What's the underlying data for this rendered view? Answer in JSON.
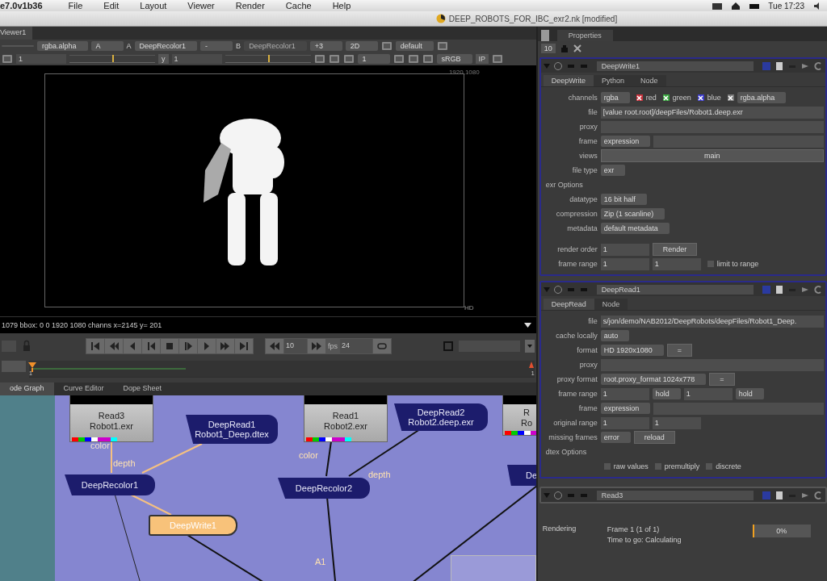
{
  "menu_bar": {
    "app": "e7.0v1b36",
    "menus": [
      "File",
      "Edit",
      "Layout",
      "Viewer",
      "Render",
      "Cache",
      "Help"
    ],
    "clock": "Tue 17:23"
  },
  "title_bar": {
    "title": "DEEP_ROBOTS_FOR_IBC_exr2.nk [modified]"
  },
  "viewer": {
    "tab": "Viewer1",
    "toolbar_1": [
      {
        "kind": "dropdown"
      },
      {
        "kind": "dropdown",
        "value": "rgba.alpha"
      },
      {
        "kind": "dropdown",
        "value": "A"
      },
      {
        "kind": "label",
        "value": "A"
      },
      {
        "kind": "dropdown",
        "value": "DeepRecolor1"
      },
      {
        "kind": "dropdown",
        "value": "-"
      },
      {
        "kind": "label",
        "value": "B"
      },
      {
        "kind": "dropdown",
        "value": "DeepRecolor1",
        "disabled": true
      },
      {
        "kind": "dropdown",
        "value": "+3"
      },
      {
        "kind": "dropdown",
        "value": "2D"
      },
      {
        "kind": "icon"
      },
      {
        "kind": "dropdown",
        "value": "default"
      },
      {
        "kind": "icon"
      }
    ],
    "toolbar_2": [
      {
        "kind": "icon"
      },
      {
        "kind": "field",
        "value": "1"
      },
      {
        "kind": "slider",
        "level": 0.5
      },
      {
        "kind": "button",
        "value": "y"
      },
      {
        "kind": "field",
        "value": "1"
      },
      {
        "kind": "slider",
        "level": 0.5
      },
      {
        "kind": "icon"
      },
      {
        "kind": "icon"
      },
      {
        "kind": "icon"
      },
      {
        "kind": "dropdown",
        "value": "1"
      },
      {
        "kind": "icon"
      },
      {
        "kind": "icon"
      },
      {
        "kind": "icon"
      },
      {
        "kind": "dropdown",
        "value": "sRGB"
      },
      {
        "kind": "button",
        "value": "IP"
      },
      {
        "kind": "icon"
      }
    ],
    "format_label": "1920,1080",
    "format_name": "HD",
    "info": "1079 bbox: 0 0 1920 1080 channs  x=2145 y= 201",
    "frame": "10",
    "fps_label": "fps",
    "fps": "24",
    "timeline": {
      "start": "1",
      "end": "1"
    }
  },
  "node_graph": {
    "tabs": [
      {
        "label": "ode Graph",
        "selected": true
      },
      {
        "label": "Curve Editor",
        "selected": false
      },
      {
        "label": "Dope Sheet",
        "selected": false
      }
    ],
    "nodes": [
      {
        "kind": "read",
        "lines": [
          "Read3",
          "Robot1.exr"
        ],
        "selected": false
      },
      {
        "kind": "deep",
        "lines": [
          "DeepRead1",
          "Robot1_Deep.dtex"
        ],
        "selected": false
      },
      {
        "kind": "read",
        "lines": [
          "Read1",
          "Robot2.exr"
        ],
        "selected": false
      },
      {
        "kind": "deep",
        "lines": [
          "DeepRead2",
          "Robot2.deep.exr"
        ],
        "selected": false
      },
      {
        "kind": "read",
        "lines": [
          "R",
          "Ro"
        ],
        "selected": false
      },
      {
        "kind": "deep",
        "lines": [
          "DeepRecolor1"
        ],
        "selected": false
      },
      {
        "kind": "deep",
        "lines": [
          "DeepRecolor2"
        ],
        "selected": false
      },
      {
        "kind": "deep",
        "lines": [
          "De"
        ],
        "selected": false
      },
      {
        "kind": "deep",
        "lines": [
          "DeepWrite1"
        ],
        "selected": true
      }
    ],
    "edge_labels": [
      "color",
      "depth",
      "color",
      "depth",
      "A1"
    ]
  },
  "properties": {
    "tab": "Properties",
    "max_panels": "10",
    "panels": [
      {
        "name": "DeepWrite1",
        "tabs": [
          {
            "label": "DeepWrite",
            "selected": true
          },
          {
            "label": "Python",
            "selected": false
          },
          {
            "label": "Node",
            "selected": false
          }
        ],
        "rows": [
          {
            "label": "channels",
            "controls": [
              {
                "kind": "dropdown",
                "value": "rgba"
              },
              {
                "kind": "check",
                "label": "red",
                "checked": true,
                "color": "#c8303a"
              },
              {
                "kind": "check",
                "label": "green",
                "checked": true,
                "color": "#3aa640"
              },
              {
                "kind": "check",
                "label": "blue",
                "checked": true,
                "color": "#3a3ac8"
              },
              {
                "kind": "check",
                "checked": true
              },
              {
                "kind": "dropdown",
                "value": "rgba.alpha"
              }
            ]
          },
          {
            "label": "file",
            "controls": [
              {
                "kind": "text",
                "value": "[value root.root]/deepFiles/Robot1.deep.exr"
              }
            ]
          },
          {
            "label": "proxy",
            "controls": [
              {
                "kind": "text"
              }
            ]
          },
          {
            "label": "frame",
            "controls": [
              {
                "kind": "dropdown",
                "value": "expression"
              },
              {
                "kind": "text"
              }
            ]
          },
          {
            "label": "views",
            "controls": [
              {
                "kind": "wide-button",
                "value": "main"
              }
            ]
          },
          {
            "label": "file type",
            "controls": [
              {
                "kind": "dropdown",
                "value": "exr"
              }
            ]
          },
          {
            "label": "exr Options",
            "controls": []
          },
          {
            "label": "datatype",
            "controls": [
              {
                "kind": "dropdown",
                "value": "16 bit half"
              }
            ]
          },
          {
            "label": "compression",
            "controls": [
              {
                "kind": "dropdown",
                "value": "Zip (1 scanline)"
              }
            ]
          },
          {
            "label": "metadata",
            "controls": [
              {
                "kind": "dropdown",
                "value": "default metadata"
              }
            ]
          },
          {
            "label": "render order",
            "controls": [
              {
                "kind": "field",
                "value": "1"
              },
              {
                "kind": "button",
                "value": "Render"
              }
            ]
          },
          {
            "label": "frame range",
            "controls": [
              {
                "kind": "field",
                "value": "1"
              },
              {
                "kind": "field",
                "value": "1"
              },
              {
                "kind": "check",
                "label": "limit to range",
                "checked": false
              }
            ]
          }
        ]
      },
      {
        "name": "DeepRead1",
        "tabs": [
          {
            "label": "DeepRead",
            "selected": true
          },
          {
            "label": "Node",
            "selected": false
          }
        ],
        "rows": [
          {
            "label": "file",
            "controls": [
              {
                "kind": "text",
                "value": "s/jon/demo/NAB2012/DeepRobots/deepFiles/Robot1_Deep."
              }
            ]
          },
          {
            "label": "cache locally",
            "controls": [
              {
                "kind": "dropdown",
                "value": "auto"
              }
            ]
          },
          {
            "label": "format",
            "controls": [
              {
                "kind": "dropdown",
                "value": "HD 1920x1080"
              },
              {
                "kind": "button",
                "value": "="
              }
            ]
          },
          {
            "label": "proxy",
            "controls": [
              {
                "kind": "text"
              }
            ]
          },
          {
            "label": "proxy format",
            "controls": [
              {
                "kind": "dropdown",
                "value": "root.proxy_format 1024x778"
              },
              {
                "kind": "button",
                "value": "="
              }
            ]
          },
          {
            "label": "frame range",
            "controls": [
              {
                "kind": "field",
                "value": "1"
              },
              {
                "kind": "dropdown",
                "value": "hold"
              },
              {
                "kind": "field",
                "value": "1"
              },
              {
                "kind": "dropdown",
                "value": "hold"
              }
            ]
          },
          {
            "label": "frame",
            "controls": [
              {
                "kind": "dropdown",
                "value": "expression"
              },
              {
                "kind": "text"
              }
            ]
          },
          {
            "label": "original range",
            "controls": [
              {
                "kind": "field",
                "value": "1"
              },
              {
                "kind": "field",
                "value": "1"
              }
            ]
          },
          {
            "label": "missing frames",
            "controls": [
              {
                "kind": "dropdown",
                "value": "error"
              },
              {
                "kind": "button",
                "value": "reload"
              }
            ]
          },
          {
            "label": "dtex Options",
            "controls": []
          },
          {
            "controls": [
              {
                "kind": "check",
                "label": "raw values",
                "checked": false
              },
              {
                "kind": "check",
                "label": "premultiply",
                "checked": false
              },
              {
                "kind": "check",
                "label": "discrete",
                "checked": false
              }
            ]
          }
        ]
      },
      {
        "name": "Read3",
        "collapsed": true
      }
    ],
    "progress": {
      "title": "Rendering",
      "frame": "Frame 1 (1 of 1)",
      "eta": "Time to go: Calculating",
      "level": 0.02,
      "percent": "0%"
    }
  }
}
